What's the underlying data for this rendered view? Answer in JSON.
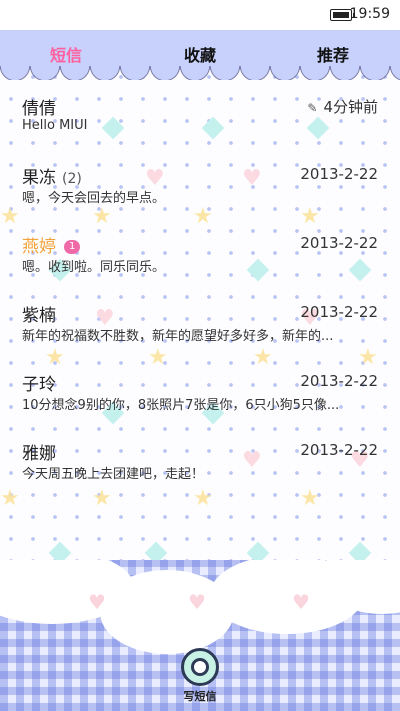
{
  "status_bar": {
    "time": "19:59"
  },
  "tabs": [
    {
      "label": "短信",
      "active": true
    },
    {
      "label": "收藏",
      "active": false
    },
    {
      "label": "推荐",
      "active": false
    }
  ],
  "conversations": [
    {
      "name": "倩倩",
      "count": "",
      "badge": "",
      "time": "4分钟前",
      "preview": "Hello MIUI",
      "draft_icon": "pencil-icon"
    },
    {
      "name": "果冻",
      "count": "(2)",
      "badge": "",
      "time": "2013-2-22",
      "preview": "嗯，今天会回去的早点。"
    },
    {
      "name": "燕婷",
      "count": "",
      "badge": "1",
      "time": "2013-2-22",
      "preview": "嗯。收到啦。同乐同乐。"
    },
    {
      "name": "紫楠",
      "count": "",
      "badge": "",
      "time": "2013-2-22",
      "preview": "新年的祝福数不胜数，新年的愿望好多好多，新年的..."
    },
    {
      "name": "子玲",
      "count": "",
      "badge": "",
      "time": "2013-2-22",
      "preview": "10分想念9别的你，8张照片7张是你，6只小狗5只像..."
    },
    {
      "name": "雅娜",
      "count": "",
      "badge": "",
      "time": "2013-2-22",
      "preview": "今天周五晚上去团建吧，走起！"
    }
  ],
  "compose": {
    "label": "写短信",
    "icon": "chat-bubble-icon"
  },
  "colors": {
    "accent": "#ff5f9e",
    "unread_name": "#f2a23a",
    "badge": "#f06aa8",
    "header": "#c7d1fb"
  }
}
